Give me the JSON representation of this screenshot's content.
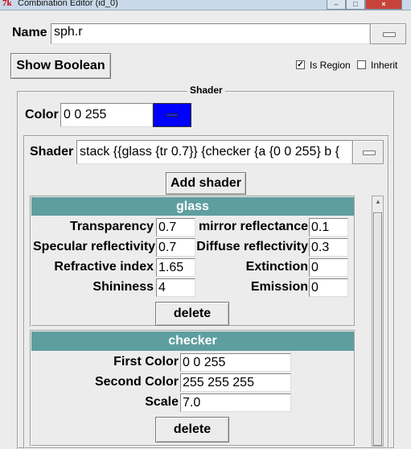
{
  "window": {
    "title": "Combination Editor (id_0)"
  },
  "name_row": {
    "label": "Name",
    "value": "sph.r"
  },
  "toolbar": {
    "show_boolean_label": "Show Boolean",
    "is_region_label": "Is Region",
    "is_region_checked": "✓",
    "inherit_label": "Inherit"
  },
  "shader_frame": {
    "title": "Shader",
    "color_label": "Color",
    "color_value": "0 0 255",
    "swatch_color": "#0000ff",
    "shader_label": "Shader",
    "shader_value": "stack {{glass {tr 0.7}} {checker {a {0 0 255} b {",
    "add_shader_label": "Add shader"
  },
  "glass": {
    "title": "glass",
    "transparency_label": "Transparency",
    "transparency": "0.7",
    "mirror_label": "mirror reflectance",
    "mirror": "0.1",
    "specular_label": "Specular reflectivity",
    "specular": "0.7",
    "diffuse_label": "Diffuse reflectivity",
    "diffuse": "0.3",
    "refractive_label": "Refractive index",
    "refractive": "1.65",
    "extinction_label": "Extinction",
    "extinction": "0",
    "shininess_label": "Shininess",
    "shininess": "4",
    "emission_label": "Emission",
    "emission": "0",
    "delete_label": "delete"
  },
  "checker": {
    "title": "checker",
    "first_color_label": "First Color",
    "first_color": "0 0 255",
    "second_color_label": "Second Color",
    "second_color": "255 255 255",
    "scale_label": "Scale",
    "scale": "7.0",
    "delete_label": "delete"
  },
  "colors": {
    "section_header": "#5f9ea0",
    "swatch": "#0000ff"
  }
}
